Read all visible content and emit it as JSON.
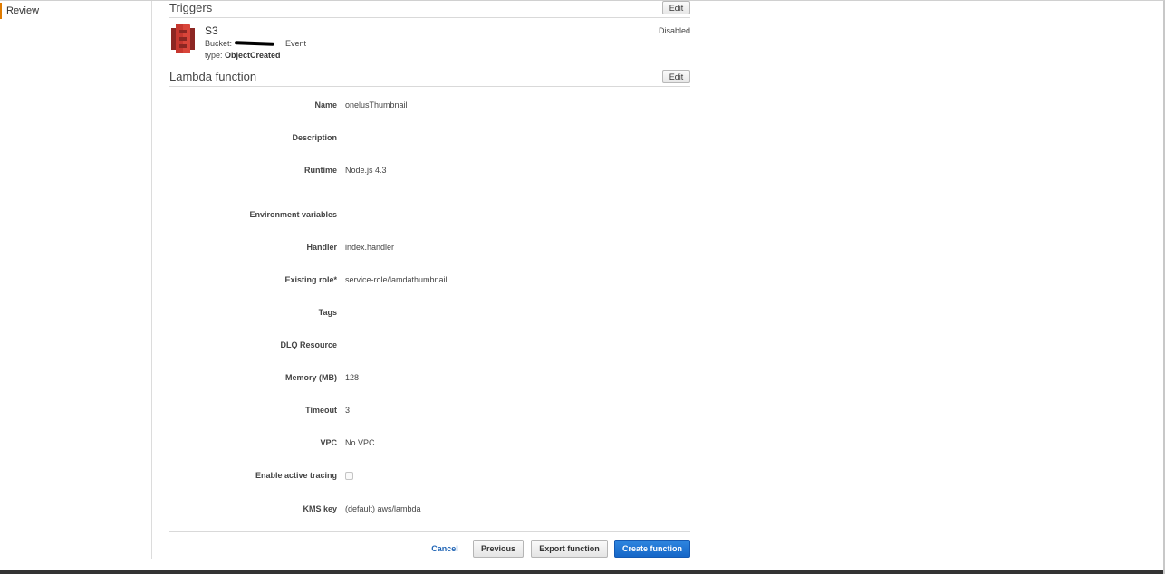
{
  "sidebar": {
    "items": [
      {
        "label": "Review",
        "active": true
      }
    ]
  },
  "triggers": {
    "title": "Triggers",
    "edit_label": "Edit",
    "items": [
      {
        "name": "S3",
        "bucket_label": "Bucket:",
        "event_label": "Event",
        "type_label": "type:",
        "type_value": "ObjectCreated",
        "status": "Disabled",
        "icon": "s3-bucket-icon"
      }
    ]
  },
  "lambda": {
    "title": "Lambda function",
    "edit_label": "Edit",
    "fields": {
      "name": {
        "label": "Name",
        "value": "onelusThumbnail"
      },
      "description": {
        "label": "Description",
        "value": ""
      },
      "runtime": {
        "label": "Runtime",
        "value": "Node.js 4.3"
      },
      "environment": {
        "label": "Environment variables",
        "value": ""
      },
      "handler": {
        "label": "Handler",
        "value": "index.handler"
      },
      "role": {
        "label": "Existing role*",
        "value": "service-role/lamdathumbnail"
      },
      "tags": {
        "label": "Tags",
        "value": ""
      },
      "dlq": {
        "label": "DLQ Resource",
        "value": ""
      },
      "memory": {
        "label": "Memory (MB)",
        "value": "128"
      },
      "timeout": {
        "label": "Timeout",
        "value": "3"
      },
      "vpc": {
        "label": "VPC",
        "value": "No VPC"
      },
      "tracing": {
        "label": "Enable active tracing",
        "checked": false
      },
      "kms": {
        "label": "KMS key",
        "value": "(default) aws/lambda"
      }
    }
  },
  "footer": {
    "cancel_label": "Cancel",
    "previous_label": "Previous",
    "export_label": "Export function",
    "create_label": "Create function"
  },
  "colors": {
    "accent": "#e07b00",
    "primary": "#1566c7",
    "link": "#1f64b5",
    "s3_red": "#c7372f"
  }
}
